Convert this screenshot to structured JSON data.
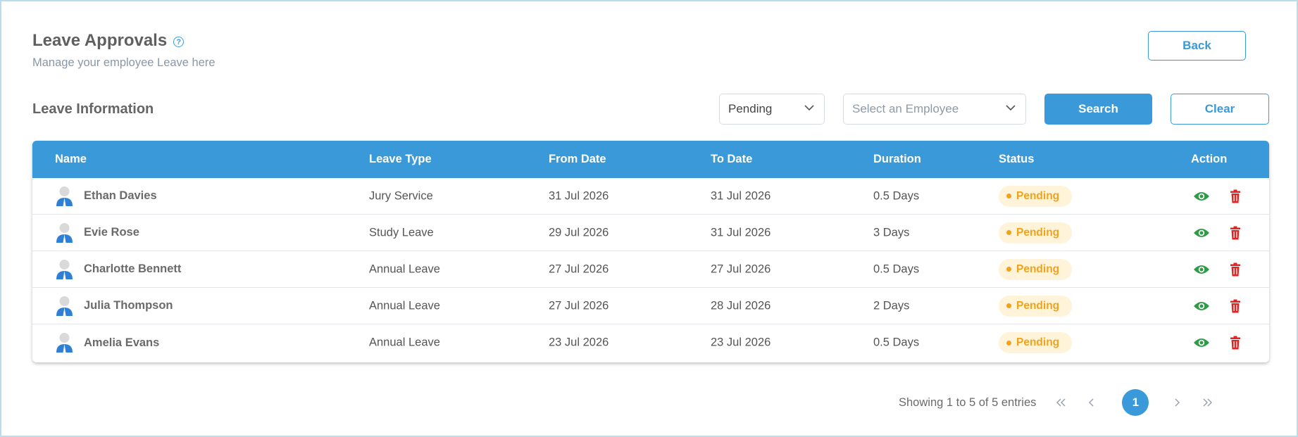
{
  "header": {
    "title": "Leave Approvals",
    "help_icon": "help-circle-icon",
    "subtitle": "Manage your employee Leave here",
    "back_label": "Back"
  },
  "filters": {
    "section_title": "Leave Information",
    "status_value": "Pending",
    "employee_placeholder": "Select an Employee",
    "search_label": "Search",
    "clear_label": "Clear"
  },
  "table": {
    "columns": [
      "Name",
      "Leave Type",
      "From Date",
      "To Date",
      "Duration",
      "Status",
      "Action"
    ],
    "rows": [
      {
        "name": "Ethan Davies",
        "type": "Jury Service",
        "from": "31 Jul 2026",
        "to": "31 Jul 2026",
        "duration": "0.5 Days",
        "status": "Pending"
      },
      {
        "name": "Evie Rose",
        "type": "Study Leave",
        "from": "29 Jul 2026",
        "to": "31 Jul 2026",
        "duration": "3 Days",
        "status": "Pending"
      },
      {
        "name": "Charlotte Bennett",
        "type": "Annual Leave",
        "from": "27 Jul 2026",
        "to": "27 Jul 2026",
        "duration": "0.5 Days",
        "status": "Pending"
      },
      {
        "name": "Julia Thompson",
        "type": "Annual Leave",
        "from": "27 Jul 2026",
        "to": "28 Jul 2026",
        "duration": "2 Days",
        "status": "Pending"
      },
      {
        "name": "Amelia Evans",
        "type": "Annual Leave",
        "from": "23 Jul 2026",
        "to": "23 Jul 2026",
        "duration": "0.5 Days",
        "status": "Pending"
      }
    ]
  },
  "pagination": {
    "info": "Showing 1 to 5 of 5 entries",
    "current_page": "1"
  },
  "colors": {
    "accent": "#3a9ad9",
    "pending_text": "#f0a21c",
    "pending_bg": "#fff4da",
    "view_icon": "#2e9b45",
    "delete_icon": "#e02424"
  }
}
